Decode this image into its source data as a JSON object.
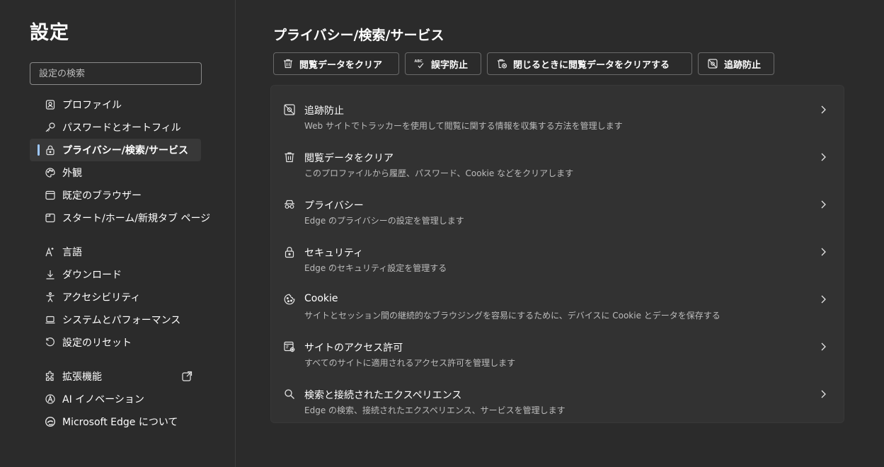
{
  "sidebar": {
    "title": "設定",
    "search_placeholder": "設定の検索",
    "items": [
      {
        "label": "プロファイル"
      },
      {
        "label": "パスワードとオートフィル"
      },
      {
        "label": "プライバシー/検索/サービス"
      },
      {
        "label": "外観"
      },
      {
        "label": "既定のブラウザー"
      },
      {
        "label": "スタート/ホーム/新規タブ ページ"
      },
      {
        "label": "言語"
      },
      {
        "label": "ダウンロード"
      },
      {
        "label": "アクセシビリティ"
      },
      {
        "label": "システムとパフォーマンス"
      },
      {
        "label": "設定のリセット"
      },
      {
        "label": "拡張機能"
      },
      {
        "label": "AI イノベーション"
      },
      {
        "label": "Microsoft Edge について"
      }
    ]
  },
  "main": {
    "title": "プライバシー/検索/サービス",
    "quick_actions": [
      {
        "label": "閲覧データをクリア"
      },
      {
        "label": "誤字防止"
      },
      {
        "label": "閉じるときに閲覧データをクリアする"
      },
      {
        "label": "追跡防止"
      }
    ],
    "rows": [
      {
        "title": "追跡防止",
        "desc": "Web サイトでトラッカーを使用して閲覧に関する情報を収集する方法を管理します"
      },
      {
        "title": "閲覧データをクリア",
        "desc": "このプロファイルから履歴、パスワード、Cookie などをクリアします"
      },
      {
        "title": "プライバシー",
        "desc": "Edge のプライバシーの設定を管理します"
      },
      {
        "title": "セキュリティ",
        "desc": "Edge のセキュリティ設定を管理する"
      },
      {
        "title": "Cookie",
        "desc": "サイトとセッション間の継続的なブラウジングを容易にするために、デバイスに Cookie とデータを保存する"
      },
      {
        "title": "サイトのアクセス許可",
        "desc": "すべてのサイトに適用されるアクセス許可を管理します"
      },
      {
        "title": "検索と接続されたエクスペリエンス",
        "desc": "Edge の検索、接続されたエクスペリエンス、サービスを管理します"
      }
    ]
  },
  "colors": {
    "background": "#2b2b2b",
    "card": "#323232",
    "accent": "#9dc7ff",
    "text": "#ffffff",
    "muted_text": "#bcbcbc"
  }
}
